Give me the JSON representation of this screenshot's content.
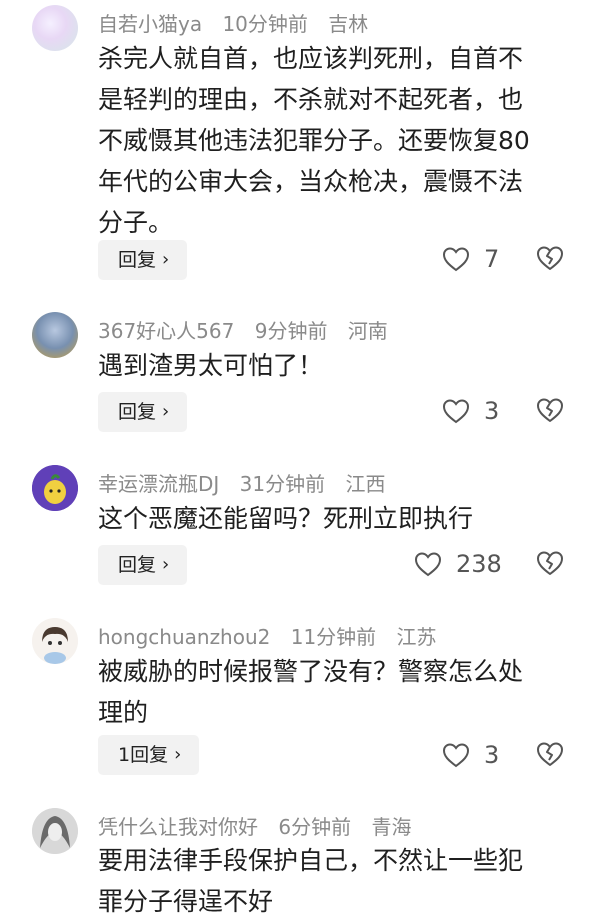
{
  "comments": [
    {
      "username": "自若小猫ya",
      "time": "10分钟前",
      "location": "吉林",
      "lines": [
        "杀完人就自首，也应该判死刑，自首不",
        "是轻判的理由，不杀就对不起死者，也",
        "不威慑其他违法犯罪分子。还要恢复80",
        "年代的公审大会，当众枪决，震慑不法",
        "分子。"
      ],
      "reply_label": "回复",
      "likes": "7"
    },
    {
      "username": "367好心人567",
      "time": "9分钟前",
      "location": "河南",
      "lines": [
        "遇到渣男太可怕了！"
      ],
      "reply_label": "回复",
      "likes": "3"
    },
    {
      "username": "幸运漂流瓶DJ",
      "time": "31分钟前",
      "location": "江西",
      "lines": [
        "这个恶魔还能留吗？死刑立即执行"
      ],
      "reply_label": "回复",
      "likes": "238"
    },
    {
      "username": "hongchuanzhou2",
      "time": "11分钟前",
      "location": "江苏",
      "lines": [
        "被威胁的时候报警了没有？警察怎么处",
        "理的"
      ],
      "reply_label": "1回复",
      "likes": "3"
    },
    {
      "username": "凭什么让我对你好",
      "time": "6分钟前",
      "location": "青海",
      "lines": [
        "要用法律手段保护自己，不然让一些犯",
        "罪分子得逞不好"
      ],
      "reply_label": "回复",
      "likes": ""
    }
  ],
  "icons": {
    "reply_chevron": "chevron-right-icon",
    "like": "heart-icon",
    "dislike": "broken-heart-icon"
  }
}
